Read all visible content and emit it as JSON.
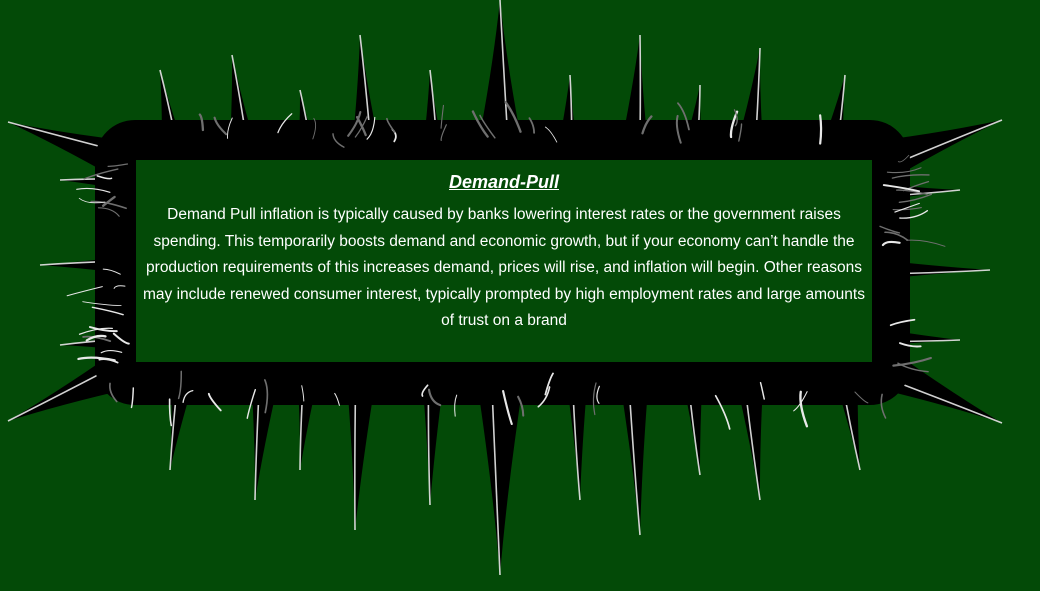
{
  "background_color": "#034a07",
  "frame": {
    "icon": "spiky-chrome-frame",
    "colors": {
      "spikes": "#000000",
      "highlight": "#e8e8e8",
      "mid": "#6f6f6f"
    }
  },
  "panel": {
    "title": "Demand-Pull",
    "body": "Demand Pull inflation is typically caused by banks lowering interest rates or the government raises spending. This temporarily boosts demand and economic growth, but if your economy can’t handle the production requirements of this increases demand, prices will rise, and inflation will begin. Other reasons may include renewed consumer interest, typically prompted by high employment rates and large amounts of trust on a brand"
  }
}
